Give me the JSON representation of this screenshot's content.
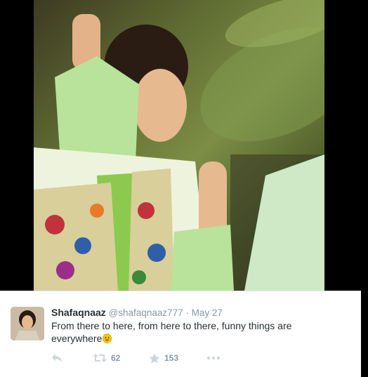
{
  "tweet": {
    "display_name": "Shafaqnaaz",
    "handle": "@shafaqnaaz777",
    "separator": "·",
    "date": "May 27",
    "text": "From there to here, from here to there, funny things are everywhere",
    "retweet_count": "62",
    "favorite_count": "153"
  },
  "icons": {
    "reply": "reply-icon",
    "retweet": "retweet-icon",
    "favorite": "star-icon",
    "more": "more-icon",
    "emoji": "smile-emoji"
  },
  "colors": {
    "name": "#292f33",
    "meta": "#8899a6",
    "action": "#ccd6dd",
    "background": "#000000"
  }
}
